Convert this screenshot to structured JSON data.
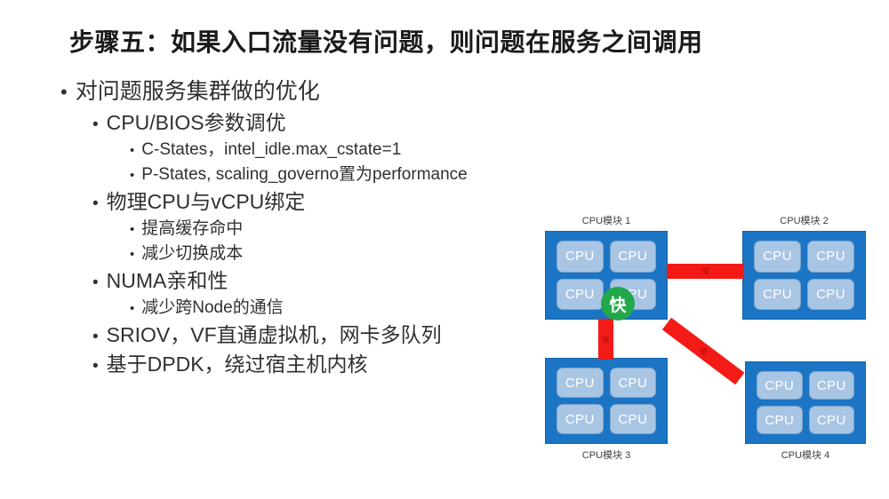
{
  "slide": {
    "title": "步骤五：如果入口流量没有问题，则问题在服务之间调用"
  },
  "bullets": [
    {
      "level": 1,
      "mark": "•",
      "text": "对问题服务集群做的优化"
    },
    {
      "level": 2,
      "mark": "•",
      "text": "CPU/BIOS参数调优"
    },
    {
      "level": 3,
      "mark": "•",
      "text": "C-States，intel_idle.max_cstate=1"
    },
    {
      "level": 3,
      "mark": "•",
      "text": "P-States, scaling_governo置为performance"
    },
    {
      "level": 2,
      "mark": "•",
      "text": "物理CPU与vCPU绑定"
    },
    {
      "level": 3,
      "mark": "•",
      "text": "提高缓存命中"
    },
    {
      "level": 3,
      "mark": "•",
      "text": "减少切换成本"
    },
    {
      "level": 2,
      "mark": "•",
      "text": "NUMA亲和性"
    },
    {
      "level": 3,
      "mark": "•",
      "text": "减少跨Node的通信"
    },
    {
      "level": 2,
      "mark": "•",
      "text": "SRIOV，VF直通虚拟机，网卡多队列"
    },
    {
      "level": 2,
      "mark": "•",
      "text": "基于DPDK，绕过宿主机内核"
    }
  ],
  "diagram": {
    "cpu_tile_label": "CPU",
    "fast_badge": "快",
    "modules": [
      {
        "id": 1,
        "label": "CPU模块 1",
        "cores": [
          "CPU",
          "CPU",
          "CPU",
          "CPU"
        ]
      },
      {
        "id": 2,
        "label": "CPU模块 2",
        "cores": [
          "CPU",
          "CPU",
          "CPU",
          "CPU"
        ]
      },
      {
        "id": 3,
        "label": "CPU模块 3",
        "cores": [
          "CPU",
          "CPU",
          "CPU",
          "CPU"
        ]
      },
      {
        "id": 4,
        "label": "CPU模块 4",
        "cores": [
          "CPU",
          "CPU",
          "CPU",
          "CPU"
        ]
      }
    ],
    "links": [
      {
        "id": "1-2",
        "label": "慢",
        "orientation": "horizontal"
      },
      {
        "id": "1-3",
        "label": "慢",
        "orientation": "vertical"
      },
      {
        "id": "1-4",
        "label": "慢",
        "orientation": "diagonal"
      }
    ],
    "colors": {
      "module_blue": "#1B75C4",
      "cpu_tile_blue": "#A9C5E4",
      "link_red": "#F41A16",
      "fast_green": "#22A84B"
    }
  }
}
